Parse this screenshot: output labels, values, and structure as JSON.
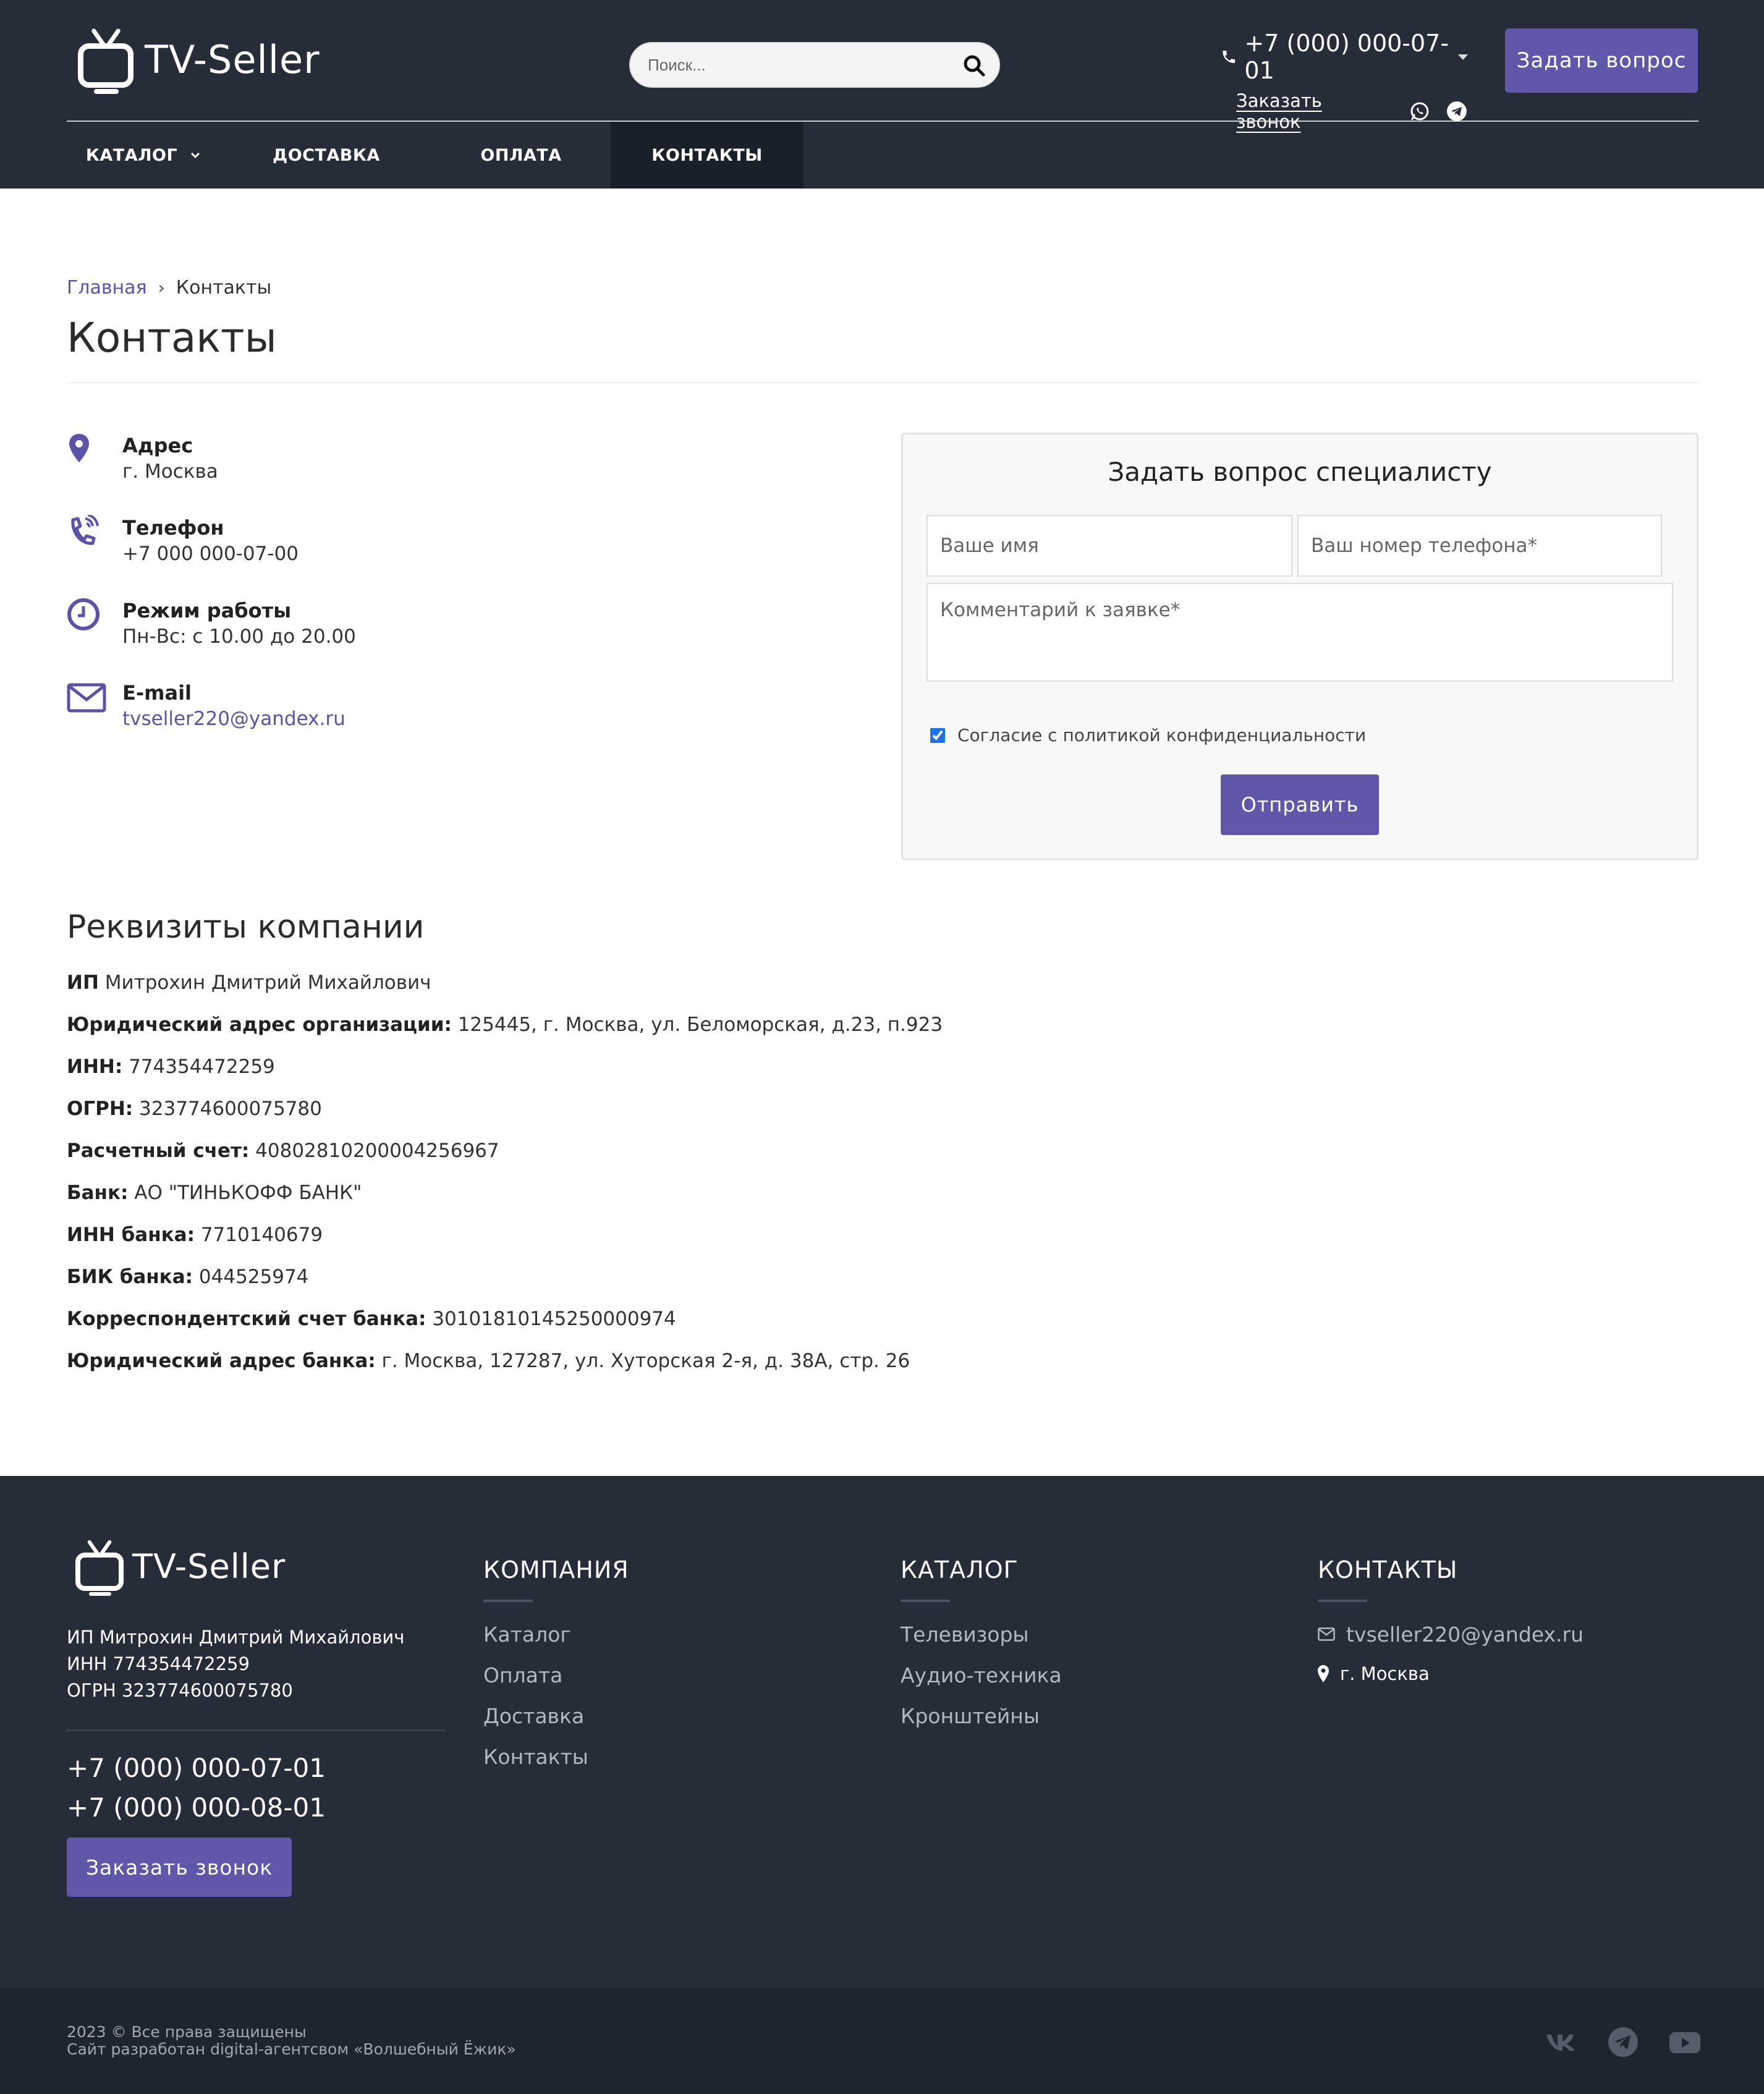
{
  "header": {
    "logo_text": "TV-Seller",
    "search_placeholder": "Поиск...",
    "phone": "+7 (000) 000-07-01",
    "callback_link": "Заказать звонок",
    "ask_button": "Задать вопрос",
    "nav": [
      {
        "label": "КАТАЛОГ",
        "has_dropdown": true
      },
      {
        "label": "ДОСТАВКА"
      },
      {
        "label": "ОПЛАТА"
      },
      {
        "label": "КОНТАКТЫ",
        "active": true
      }
    ]
  },
  "breadcrumb": {
    "home": "Главная",
    "separator": "›",
    "current": "Контакты"
  },
  "page_title": "Контакты",
  "contacts": [
    {
      "icon": "map-pin-icon",
      "label": "Адрес",
      "value": "г. Москва"
    },
    {
      "icon": "phone-ringing-icon",
      "label": "Телефон",
      "value": "+7 000 000-07-00"
    },
    {
      "icon": "clock-icon",
      "label": "Режим работы",
      "value": "Пн-Вс: с 10.00 до 20.00"
    },
    {
      "icon": "envelope-icon",
      "label": "E-mail",
      "value": "tvseller220@yandex.ru"
    }
  ],
  "form": {
    "title": "Задать вопрос специалисту",
    "name_placeholder": "Ваше имя",
    "phone_placeholder": "Ваш номер телефона*",
    "comment_placeholder": "Комментарий к заявке*",
    "consent_label": "Согласие с политикой конфиденциальности",
    "consent_checked": true,
    "submit_label": "Отправить"
  },
  "requisites": {
    "title": "Реквизиты компании",
    "rows": [
      {
        "label": "ИП",
        "value": " Митрохин Дмитрий Михайлович"
      },
      {
        "label": "Юридический адрес организации:",
        "value": " 125445, г. Москва, ул. Беломорская, д.23, п.923"
      },
      {
        "label": "ИНН:",
        "value": " 774354472259"
      },
      {
        "label": "ОГРН:",
        "value": " 323774600075780"
      },
      {
        "label": "Расчетный счет:",
        "value": " 40802810200004256967"
      },
      {
        "label": "Банк:",
        "value": " АО \"ТИНЬКОФФ БАНК\""
      },
      {
        "label": "ИНН банка:",
        "value": " 7710140679"
      },
      {
        "label": "БИК банка:",
        "value": " 044525974"
      },
      {
        "label": "Корреспондентский счет банка:",
        "value": " 30101810145250000974"
      },
      {
        "label": "Юридический адрес банка:",
        "value": " г. Москва, 127287, ул. Хуторская 2-я, д. 38А, стр. 26"
      }
    ]
  },
  "footer": {
    "logo_text": "TV-Seller",
    "company_lines": [
      "ИП Митрохин Дмитрий Михайлович",
      "ИНН 774354472259",
      "ОГРН 323774600075780"
    ],
    "phones": [
      "+7 (000) 000-07-01",
      "+7 (000) 000-08-01"
    ],
    "callback_button": "Заказать звонок",
    "columns": {
      "company": {
        "title": "КОМПАНИЯ",
        "links": [
          "Каталог",
          "Оплата",
          "Доставка",
          "Контакты"
        ]
      },
      "catalog": {
        "title": "КАТАЛОГ",
        "links": [
          "Телевизоры",
          "Аудио-техника",
          "Кронштейны"
        ]
      },
      "contacts": {
        "title": "КОНТАКТЫ",
        "email": "tvseller220@yandex.ru",
        "city": "г. Москва"
      }
    },
    "copyright": "2023 © Все права защищены",
    "developer": "Сайт разработан digital-агентсвом «Волшебный Ёжик»",
    "social": [
      "vk-icon",
      "telegram-icon",
      "youtube-icon"
    ]
  },
  "colors": {
    "header_bg": "#262d38",
    "accent": "#6057aa",
    "link": "#5c52a8",
    "footer_bottom": "#1f252e"
  }
}
